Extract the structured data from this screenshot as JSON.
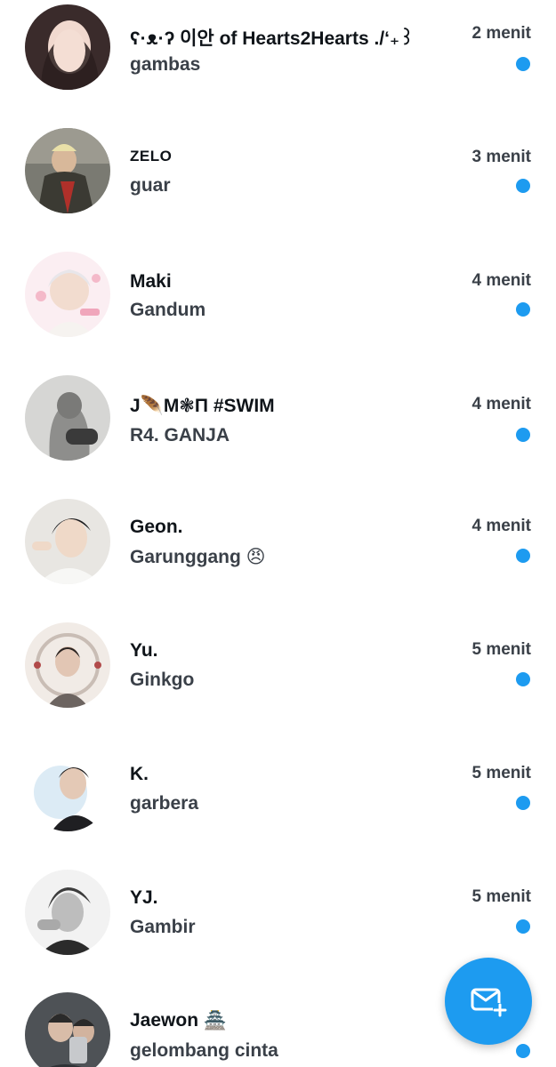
{
  "conversations": [
    {
      "name": "ʕ·ᴥ·ʔ 이안 of Hearts2Hearts ./‘₊꒱",
      "preview": "gambas",
      "time": "2 menit",
      "unread": true,
      "avatar_color": "#3a2b2b"
    },
    {
      "name": "ZELO",
      "preview": "guar",
      "time": "3 menit",
      "unread": true,
      "avatar_color": "#6b5a4a"
    },
    {
      "name": "Maki",
      "preview": "Gandum",
      "time": "4 menit",
      "unread": true,
      "avatar_color": "#f3d6e0"
    },
    {
      "name": "J🪶M❃П #SWIM",
      "preview": "R4. GANJA",
      "time": "4 menit",
      "unread": true,
      "avatar_color": "#8a8a8a"
    },
    {
      "name": "Geon.",
      "preview": "Garunggang 😠",
      "time": "4 menit",
      "unread": true,
      "avatar_color": "#d9d4cc"
    },
    {
      "name": "Yu.",
      "preview": "Ginkgo",
      "time": "5 menit",
      "unread": true,
      "avatar_color": "#e6dcd6"
    },
    {
      "name": "K.",
      "preview": "garbera",
      "time": "5 menit",
      "unread": true,
      "avatar_color": "#c9d9e8"
    },
    {
      "name": "YJ.",
      "preview": "Gambir",
      "time": "5 menit",
      "unread": true,
      "avatar_color": "#9a9a9a"
    },
    {
      "name": "Jaewon 🏯",
      "preview": "gelombang cinta",
      "time": "",
      "unread": true,
      "avatar_color": "#5a5f66"
    }
  ],
  "fab": {
    "icon": "new-message-icon",
    "color": "#1d9bf0"
  }
}
